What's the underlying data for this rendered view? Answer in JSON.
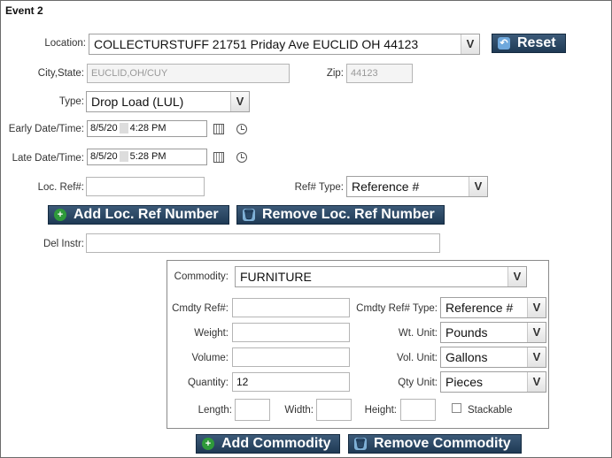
{
  "section_title": "Event 2",
  "location": {
    "label": "Location:",
    "value": "COLLECTURSTUFF 21751 Priday Ave EUCLID OH 44123"
  },
  "reset_button": "Reset",
  "city_state": {
    "label": "City,State:",
    "value": "EUCLID,OH/CUY"
  },
  "zip": {
    "label": "Zip:",
    "value": "44123"
  },
  "type": {
    "label": "Type:",
    "value": "Drop Load (LUL)"
  },
  "early_dt": {
    "label": "Early Date/Time:",
    "date": "8/5/20",
    "time": "4:28 PM"
  },
  "late_dt": {
    "label": "Late Date/Time:",
    "date": "8/5/20",
    "time": "5:28 PM"
  },
  "loc_ref": {
    "label": "Loc. Ref#:",
    "value": ""
  },
  "ref_type": {
    "label": "Ref# Type:",
    "value": "Reference #"
  },
  "add_loc_ref_button": "Add Loc. Ref Number",
  "remove_loc_ref_button": "Remove Loc. Ref Number",
  "del_instr": {
    "label": "Del Instr:",
    "value": ""
  },
  "commodity": {
    "label": "Commodity:",
    "value": "FURNITURE",
    "cmdty_ref_label": "Cmdty Ref#:",
    "cmdty_ref_value": "",
    "cmdty_ref_type_label": "Cmdty Ref# Type:",
    "cmdty_ref_type_value": "Reference #",
    "weight_label": "Weight:",
    "weight_value": "",
    "wt_unit_label": "Wt. Unit:",
    "wt_unit_value": "Pounds",
    "volume_label": "Volume:",
    "volume_value": "",
    "vol_unit_label": "Vol. Unit:",
    "vol_unit_value": "Gallons",
    "quantity_label": "Quantity:",
    "quantity_value": "12",
    "qty_unit_label": "Qty Unit:",
    "qty_unit_value": "Pieces",
    "length_label": "Length:",
    "width_label": "Width:",
    "height_label": "Height:",
    "stackable_label": "Stackable"
  },
  "add_commodity_button": "Add Commodity",
  "remove_commodity_button": "Remove Commodity",
  "icons": {
    "dropdown_arrow": "V",
    "add": "+",
    "remove": "🗑",
    "undo": "↶"
  }
}
